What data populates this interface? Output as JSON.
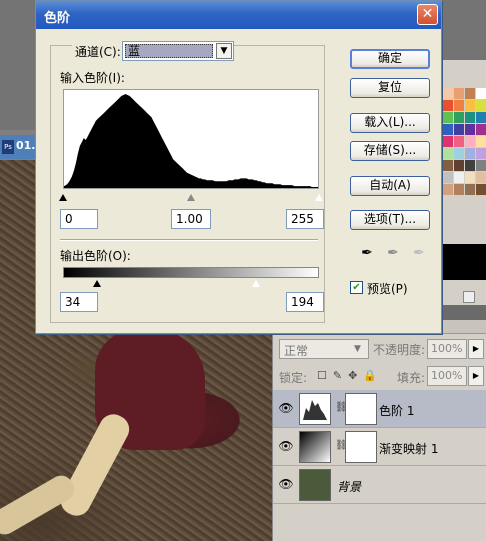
{
  "window": {
    "title": "色阶"
  },
  "channel": {
    "label": "通道(C):",
    "value": "蓝"
  },
  "input_levels": {
    "label": "输入色阶(I):",
    "black": "0",
    "gamma": "1.00",
    "white": "255"
  },
  "output_levels": {
    "label": "输出色阶(O):",
    "black": "34",
    "white": "194"
  },
  "buttons": {
    "ok": "确定",
    "reset": "复位",
    "load": "载入(L)...",
    "save": "存储(S)...",
    "auto": "自动(A)",
    "options": "选项(T)..."
  },
  "preview": {
    "label": "预览(P)",
    "checked": true
  },
  "taskbar": {
    "doc_label": "01."
  },
  "layers_panel": {
    "blend_mode": "正常",
    "opacity_label": "不透明度:",
    "opacity_value": "100%",
    "lock_label": "锁定:",
    "fill_label": "填充:",
    "fill_value": "100%",
    "layers": [
      {
        "name": "色阶 1",
        "selected": true
      },
      {
        "name": "渐变映射 1",
        "selected": false
      },
      {
        "name": "背景",
        "selected": false
      }
    ]
  },
  "histogram": {
    "values": [
      2,
      3,
      5,
      8,
      12,
      18,
      26,
      36,
      44,
      48,
      52,
      50,
      54,
      58,
      62,
      66,
      70,
      72,
      74,
      76,
      78,
      80,
      82,
      84,
      86,
      88,
      90,
      92,
      94,
      96,
      97,
      98,
      97,
      96,
      94,
      92,
      90,
      88,
      86,
      84,
      82,
      80,
      78,
      76,
      74,
      70,
      66,
      62,
      58,
      54,
      50,
      46,
      42,
      38,
      34,
      30,
      28,
      26,
      24,
      22,
      20,
      18,
      16,
      15,
      14,
      13,
      12,
      11,
      10,
      10,
      9,
      9,
      8,
      8,
      8,
      8,
      7,
      7,
      7,
      7,
      7,
      7,
      7,
      8,
      8,
      8,
      9,
      9,
      9,
      10,
      10,
      10,
      10,
      9,
      9,
      9,
      8,
      8,
      7,
      7,
      6,
      6,
      5,
      5,
      5,
      5,
      4,
      4,
      4,
      4,
      3,
      3,
      3,
      3,
      3,
      3,
      2,
      2,
      2,
      2,
      2,
      2,
      2,
      2,
      2,
      1,
      1,
      1,
      1
    ]
  },
  "colors": {
    "title_bar": "#2f64c4",
    "dialog_bg": "#ece9d8",
    "selected_layer": "#b7bac7"
  }
}
